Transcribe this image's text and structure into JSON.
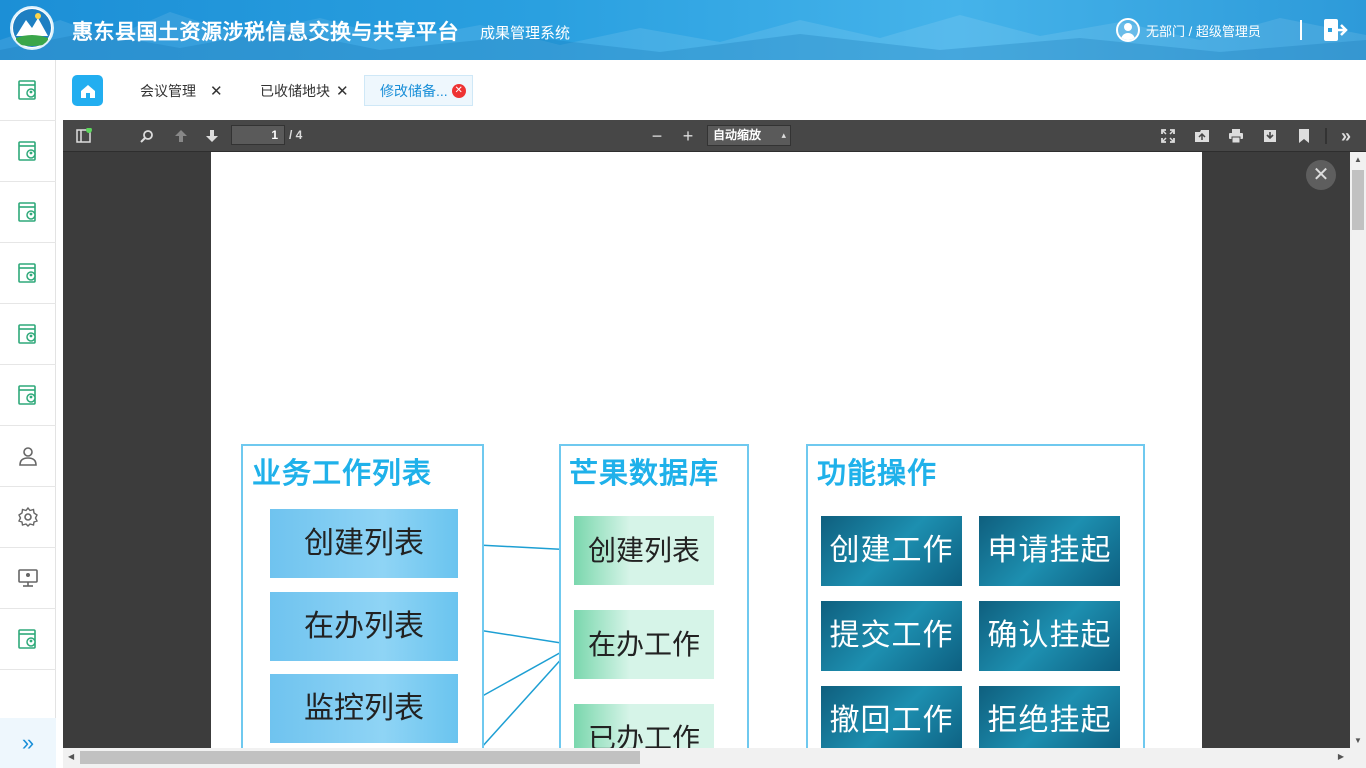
{
  "header": {
    "title": "惠东县国土资源涉税信息交换与共享平台",
    "subtitle": "成果管理系统",
    "user_text": "无部门 / 超级管理员"
  },
  "tabs": [
    {
      "label": "会议管理"
    },
    {
      "label": "已收储地块"
    },
    {
      "label": "修改储备..."
    }
  ],
  "pdf_toolbar": {
    "page_current": "1",
    "page_total": "/ 4",
    "zoom": "自动缩放"
  },
  "diagram": {
    "panel1_title": "业务工作列表",
    "panel2_title": "芒果数据库",
    "panel3_title": "功能操作",
    "work_lists": [
      "创建列表",
      "在办列表",
      "监控列表"
    ],
    "db_items": [
      "创建列表",
      "在办工作",
      "已办工作"
    ],
    "actions": [
      "创建工作",
      "申请挂起",
      "提交工作",
      "确认挂起",
      "撤回工作",
      "拒绝挂起"
    ]
  },
  "colors": {
    "header": "#2aa0e0",
    "accent": "#1a8fd8",
    "panel_title": "#1fb1ea"
  }
}
